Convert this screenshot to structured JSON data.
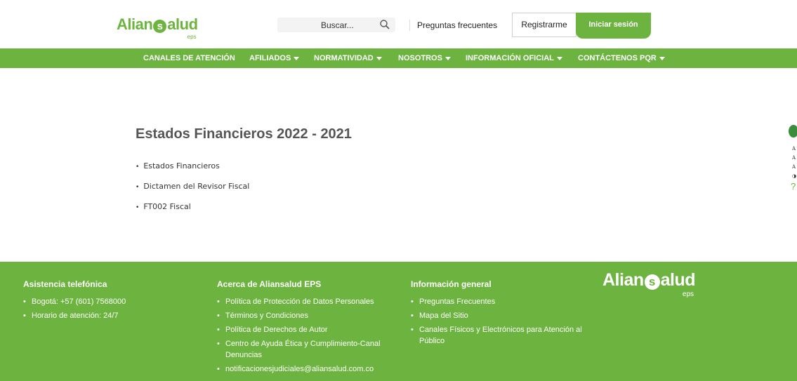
{
  "header": {
    "logo": {
      "prefix": "Alian",
      "ball": "s",
      "suffix": "alud",
      "sub": "eps"
    },
    "search": {
      "placeholder": "Buscar...",
      "value": "",
      "icon": "search-icon"
    },
    "faq_label": "Preguntas frecuentes",
    "register_label": "Registrarme",
    "login_label": "Iniciar sesión"
  },
  "nav": {
    "items": [
      {
        "label": "CANALES DE ATENCIÓN",
        "dropdown": false
      },
      {
        "label": "AFILIADOS",
        "dropdown": true
      },
      {
        "label": "NORMATIVIDAD",
        "dropdown": true
      },
      {
        "label": "NOSOTROS",
        "dropdown": true
      },
      {
        "label": "INFORMACIÓN OFICIAL",
        "dropdown": true
      },
      {
        "label": "CONTÁCTENOS PQR",
        "dropdown": true
      }
    ]
  },
  "main": {
    "title": "Estados Financieros 2022 - 2021",
    "documents": [
      "Estados Financieros",
      "Dictamen del Revisor Fiscal",
      "FT002 Fiscal"
    ]
  },
  "accessibility": {
    "icon": "accessibility-icon",
    "items": [
      "A",
      "A",
      "A",
      "◑"
    ],
    "help": "?"
  },
  "footer": {
    "phone": {
      "title": "Asistencia telefónica",
      "items": [
        "Bogotá: +57 (601) 7568000",
        "Horario de atención: 24/7"
      ]
    },
    "about": {
      "title": "Acerca de Aliansalud EPS",
      "items": [
        "Política de Protección de Datos Personales",
        "Términos y Condiciones",
        "Política de Derechos de Autor",
        "Centro de Ayuda Ética y Cumplimiento-Canal Denuncias",
        "notificacionesjudiciales@aliansalud.com.co"
      ]
    },
    "general": {
      "title": "Información general",
      "items": [
        "Preguntas Frecuentes",
        "Mapa del Sitio",
        "Canales Físicos y Electrónicos para Atención al Público"
      ]
    },
    "logo": {
      "prefix": "Alian",
      "ball": "s",
      "suffix": "alud",
      "sub": "eps"
    }
  },
  "colors": {
    "brand_green": "#6db33f",
    "title_gray": "#555555",
    "accessibility_green": "#3a8d3a"
  }
}
